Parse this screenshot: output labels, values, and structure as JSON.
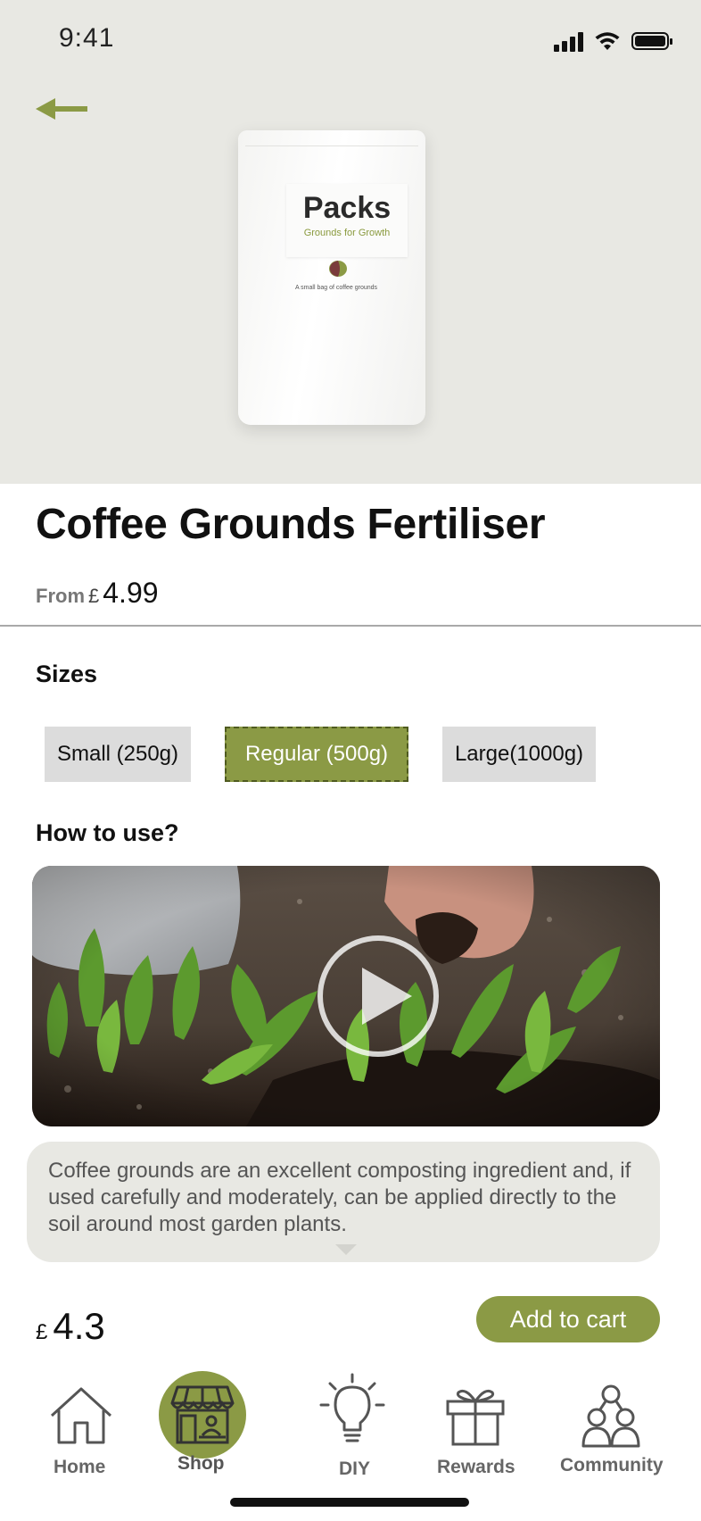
{
  "status_bar": {
    "time": "9:41"
  },
  "product": {
    "title": "Coffee Grounds Fertiliser",
    "price_prefix": "From",
    "currency": "£",
    "from_price": "4.99",
    "pouch": {
      "brand": "Packs",
      "tagline": "Grounds for Growth",
      "small_text": "A small bag of coffee grounds"
    }
  },
  "sizes": {
    "heading": "Sizes",
    "options": [
      {
        "label": "Small (250g)",
        "selected": false
      },
      {
        "label": "Regular (500g)",
        "selected": true
      },
      {
        "label": "Large(1000g)",
        "selected": false
      }
    ]
  },
  "how_to_use": {
    "heading": "How to use?",
    "description": "Coffee grounds are an excellent composting ingredient and, if used carefully and moderately, can be applied directly to the soil around most garden plants."
  },
  "footer": {
    "currency": "£",
    "total": "4.3",
    "cart_label": "Add to cart"
  },
  "tabs": [
    {
      "label": "Home",
      "icon": "home-icon",
      "active": false
    },
    {
      "label": "Shop",
      "icon": "shop-icon",
      "active": true
    },
    {
      "label": "DIY",
      "icon": "lightbulb-icon",
      "active": false
    },
    {
      "label": "Rewards",
      "icon": "gift-icon",
      "active": false
    },
    {
      "label": "Community",
      "icon": "community-icon",
      "active": false
    }
  ],
  "colors": {
    "accent": "#8b9a45",
    "hero_background": "#e8e8e3",
    "chip_background": "#dcdcdc"
  }
}
